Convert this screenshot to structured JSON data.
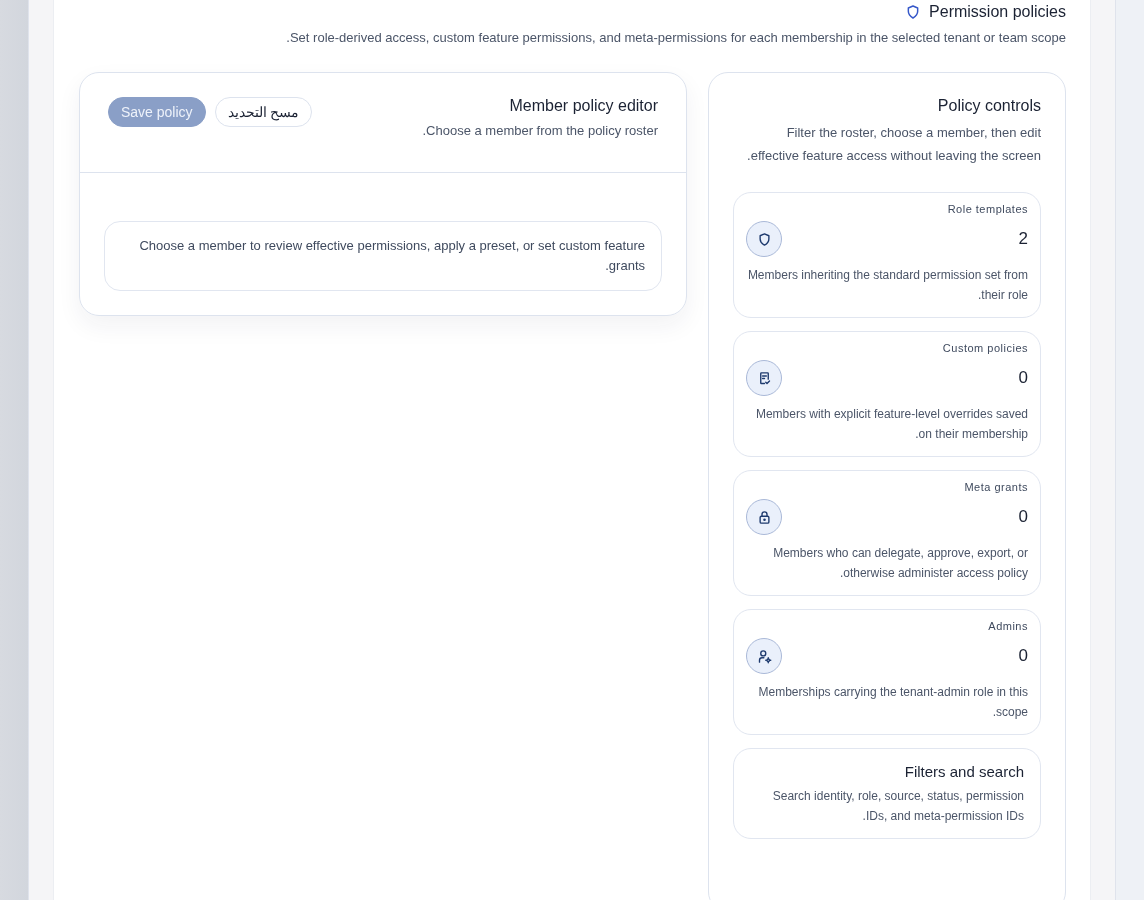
{
  "header": {
    "title": "Permission policies",
    "description": "Set role-derived access, custom feature permissions, and meta-permissions for each membership in the selected tenant or team scope."
  },
  "editor": {
    "title": "Member policy editor",
    "subtitle": "Choose a member from the policy roster.",
    "buttons": [
      {
        "label": "Save policy",
        "kind": "primary",
        "disabled": true
      },
      {
        "label": "مسح التحديد",
        "kind": "secondary",
        "disabled": false
      }
    ],
    "empty_message": "Choose a member to review effective permissions, apply a preset, or set custom feature grants."
  },
  "controls": {
    "title": "Policy controls",
    "description": "Filter the roster, choose a member, then edit effective feature access without leaving the screen.",
    "stats": [
      {
        "label": "Role templates",
        "value": "2",
        "description": "Members inheriting the standard permission set from their role."
      },
      {
        "label": "Custom policies",
        "value": "0",
        "description": "Members with explicit feature-level overrides saved on their membership."
      },
      {
        "label": "Meta grants",
        "value": "0",
        "description": "Members who can delegate, approve, export, or otherwise administer access policy."
      },
      {
        "label": "Admins",
        "value": "0",
        "description": "Memberships carrying the tenant-admin role in this scope."
      }
    ],
    "filters": {
      "title": "Filters and search",
      "description": "Search identity, role, source, status, permission IDs, and meta-permission IDs."
    }
  }
}
